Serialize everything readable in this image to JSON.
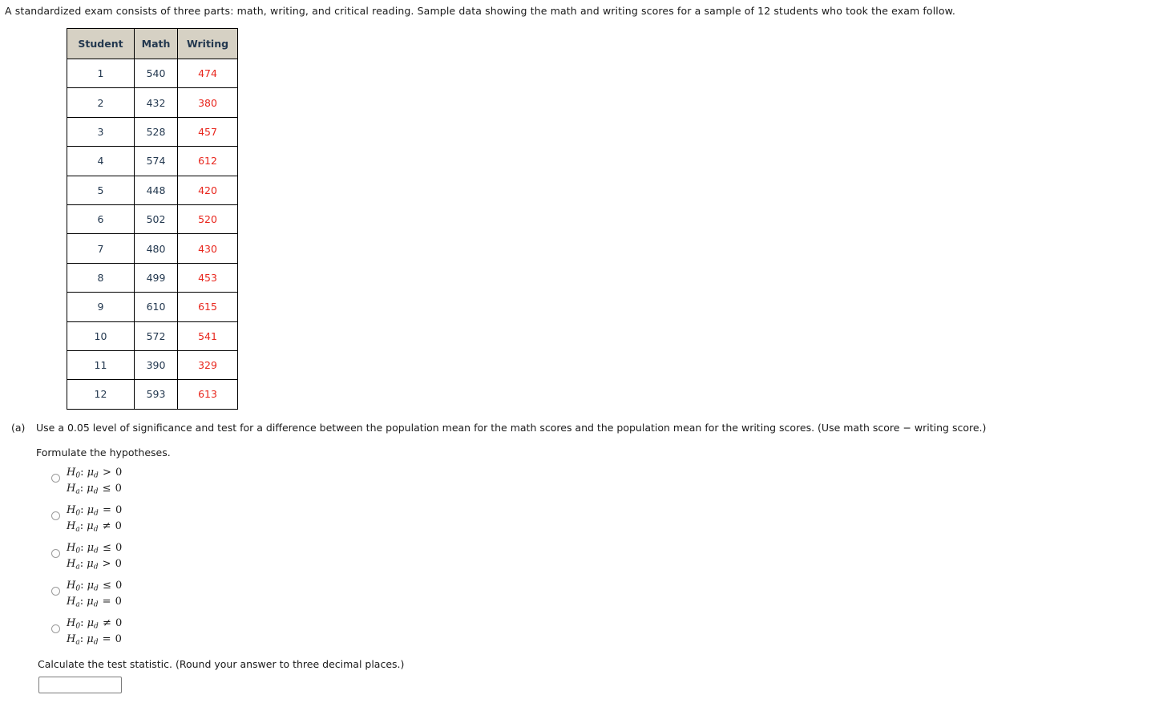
{
  "intro": {
    "text": "A standardized exam consists of three parts: math, writing, and critical reading. Sample data showing the math and writing scores for a sample of 12 students who took the exam follow."
  },
  "table": {
    "headers": [
      "Student",
      "Math",
      "Writing"
    ],
    "rows": [
      {
        "student": "1",
        "math": "540",
        "writing": "474"
      },
      {
        "student": "2",
        "math": "432",
        "writing": "380"
      },
      {
        "student": "3",
        "math": "528",
        "writing": "457"
      },
      {
        "student": "4",
        "math": "574",
        "writing": "612"
      },
      {
        "student": "5",
        "math": "448",
        "writing": "420"
      },
      {
        "student": "6",
        "math": "502",
        "writing": "520"
      },
      {
        "student": "7",
        "math": "480",
        "writing": "430"
      },
      {
        "student": "8",
        "math": "499",
        "writing": "453"
      },
      {
        "student": "9",
        "math": "610",
        "writing": "615"
      },
      {
        "student": "10",
        "math": "572",
        "writing": "541"
      },
      {
        "student": "11",
        "math": "390",
        "writing": "329"
      },
      {
        "student": "12",
        "math": "593",
        "writing": "613"
      }
    ],
    "header_bg": "#d6d1c4",
    "writing_color": "#e8251c"
  },
  "part_a": {
    "label": "(a)",
    "question": "Use a 0.05 level of significance and test for a difference between the population mean for the math scores and the population mean for the writing scores. (Use math score − writing score.)",
    "formulate": "Formulate the hypotheses.",
    "options": [
      {
        "null_op": ">",
        "alt_op": "≤",
        "null_value": "0",
        "alt_value": "0",
        "selected": false
      },
      {
        "null_op": "=",
        "alt_op": "≠",
        "null_value": "0",
        "alt_value": "0",
        "selected": false
      },
      {
        "null_op": "≤",
        "alt_op": ">",
        "null_value": "0",
        "alt_value": "0",
        "selected": false
      },
      {
        "null_op": "≤",
        "alt_op": "=",
        "null_value": "0",
        "alt_value": "0",
        "selected": false
      },
      {
        "null_op": "≠",
        "alt_op": "=",
        "null_value": "0",
        "alt_value": "0",
        "selected": false
      }
    ],
    "calculate_text": "Calculate the test statistic. (Round your answer to three decimal places.)",
    "answer_value": "",
    "answer_placeholder": ""
  }
}
